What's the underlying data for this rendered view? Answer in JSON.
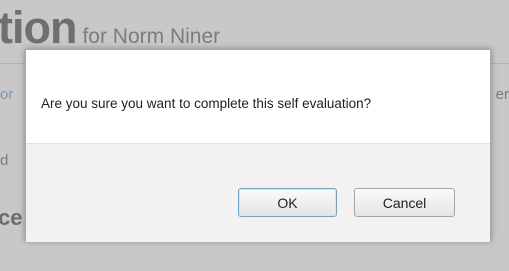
{
  "background": {
    "title_large": "tion",
    "title_small": "for Norm Niner",
    "fragment_tab": "or",
    "fragment_right": "er",
    "fragment_left_d": "d",
    "fragment_left_ce": "ce"
  },
  "dialog": {
    "message": "Are you sure you want to complete this self evaluation?",
    "ok_label": "OK",
    "cancel_label": "Cancel"
  },
  "colors": {
    "overlay": "#c8c8c8",
    "dialog_bg": "#ffffff",
    "footer_bg": "#f2f2f2",
    "ok_border": "#5fa9dd"
  }
}
